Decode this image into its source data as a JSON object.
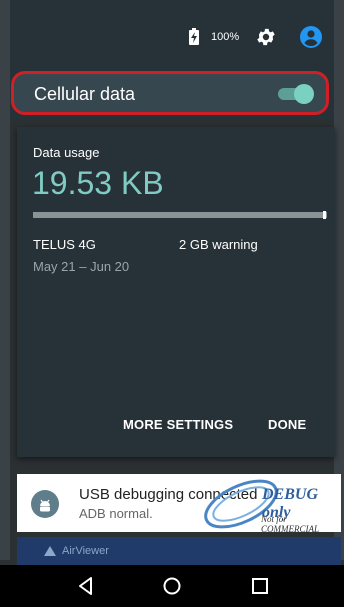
{
  "status": {
    "battery": "100%"
  },
  "quick_settings": {
    "cellular_label": "Cellular data",
    "cellular_enabled": true
  },
  "data_usage": {
    "label": "Data usage",
    "value": "19.53 KB",
    "carrier": "TELUS 4G",
    "warning": "2 GB warning",
    "period": "May 21 – Jun 20",
    "more_settings": "MORE SETTINGS",
    "done": "DONE"
  },
  "notification": {
    "title": "USB debugging connected",
    "text": "ADB normal.",
    "watermark": "DEBUG only",
    "watermark_sub": "Not for COMMERCIAL"
  },
  "background_app": {
    "name": "AirViewer"
  },
  "colors": {
    "accent": "#80cbc4",
    "highlight": "#d11f26",
    "panel": "#263238"
  },
  "icons": {
    "battery": "battery-charging-icon",
    "settings": "gear-icon",
    "account": "account-circle-icon",
    "back": "back-icon",
    "home": "home-icon",
    "recents": "recents-icon"
  }
}
